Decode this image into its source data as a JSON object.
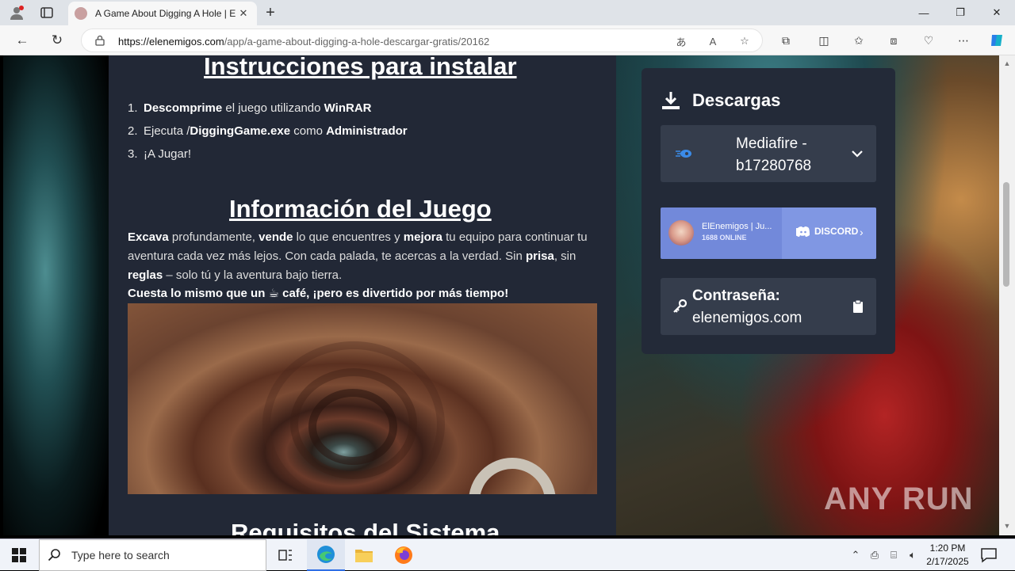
{
  "browser": {
    "tab_title": "A Game About Digging A Hole | E",
    "url_domain": "https://elenemigos.com",
    "url_path": "/app/a-game-about-digging-a-hole-descargar-gratis/20162"
  },
  "page": {
    "instructions_heading": "Instrucciones para instalar",
    "steps": [
      {
        "num": "1.",
        "bold1": "Descomprime",
        "text1": " el juego utilizando ",
        "bold2": "WinRAR",
        "text2": ""
      },
      {
        "num": "2.",
        "bold1": "",
        "text1": "Ejecuta /",
        "bold2": "DiggingGame.exe",
        "text2": " como ",
        "bold3": "Administrador"
      },
      {
        "num": "3.",
        "text1": "¡A Jugar!"
      }
    ],
    "info_heading": "Información del Juego",
    "desc": {
      "b1": "Excava",
      "t1": " profundamente, ",
      "b2": "vende",
      "t2": " lo que encuentres y ",
      "b3": "mejora",
      "t3": " tu equipo para continuar tu aventura cada vez más lejos. Con cada palada, te acercas a la verdad. Sin ",
      "b4": "prisa",
      "t4": ", sin ",
      "b5": "reglas",
      "t5": " – solo tú y la aventura bajo tierra."
    },
    "tagline_pre": "Cuesta lo mismo que un ",
    "tagline_icon": "☕",
    "tagline_post": " café, ¡pero es divertido por más tiempo!",
    "requirements_heading": "Requisitos del Sistema"
  },
  "downloads": {
    "title": "Descargas",
    "mirror_label": "Mediafire - b17280768",
    "discord_name": "ElEnemigos | Ju...",
    "discord_online": "1688 ONLINE",
    "discord_brand": "DISCORD",
    "password_label": "Contraseña:",
    "password_value": "elenemigos.com"
  },
  "watermark": "ANY RUN",
  "taskbar": {
    "search_placeholder": "Type here to search",
    "time": "1:20 PM",
    "date": "2/17/2025"
  },
  "colors": {
    "content_bg": "#222836",
    "panel_bg": "#232a38",
    "discord": "#7289da"
  }
}
